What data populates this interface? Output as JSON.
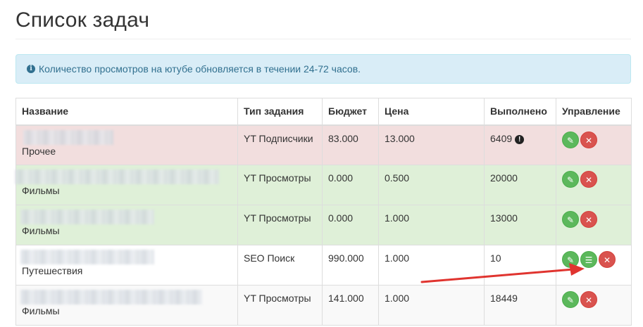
{
  "page": {
    "title": "Список задач"
  },
  "alert": {
    "text": "Количество просмотров на ютубе обновляется в течении 24-72 часов."
  },
  "table": {
    "headers": [
      "Название",
      "Тип задания",
      "Бюджет",
      "Цена",
      "Выполнено",
      "Управление"
    ],
    "rows": [
      {
        "category": "Прочее",
        "type": "YT Подписчики",
        "budget": "83.000",
        "price": "13.000",
        "done": "6409"
      },
      {
        "category": "Фильмы",
        "type": "YT Просмотры",
        "budget": "0.000",
        "price": "0.500",
        "done": "20000"
      },
      {
        "category": "Фильмы",
        "type": "YT Просмотры",
        "budget": "0.000",
        "price": "1.000",
        "done": "13000"
      },
      {
        "category": "Путешествия",
        "type": "SEO Поиск",
        "budget": "990.000",
        "price": "1.000",
        "done": "10"
      },
      {
        "category": "Фильмы",
        "type": "YT Просмотры",
        "budget": "141.000",
        "price": "1.000",
        "done": "18449"
      }
    ]
  },
  "icons": {
    "info": "info-circle-icon",
    "warning": "exclamation-circle-icon",
    "edit": "pencil-icon",
    "list": "list-icon",
    "delete": "close-icon"
  },
  "colors": {
    "alert_bg": "#d9edf7",
    "danger_row": "#f2dede",
    "success_row": "#dff0d8",
    "edit_green": "#5cb85c",
    "delete_red": "#d9534f",
    "arrow_red": "#e0342f"
  }
}
